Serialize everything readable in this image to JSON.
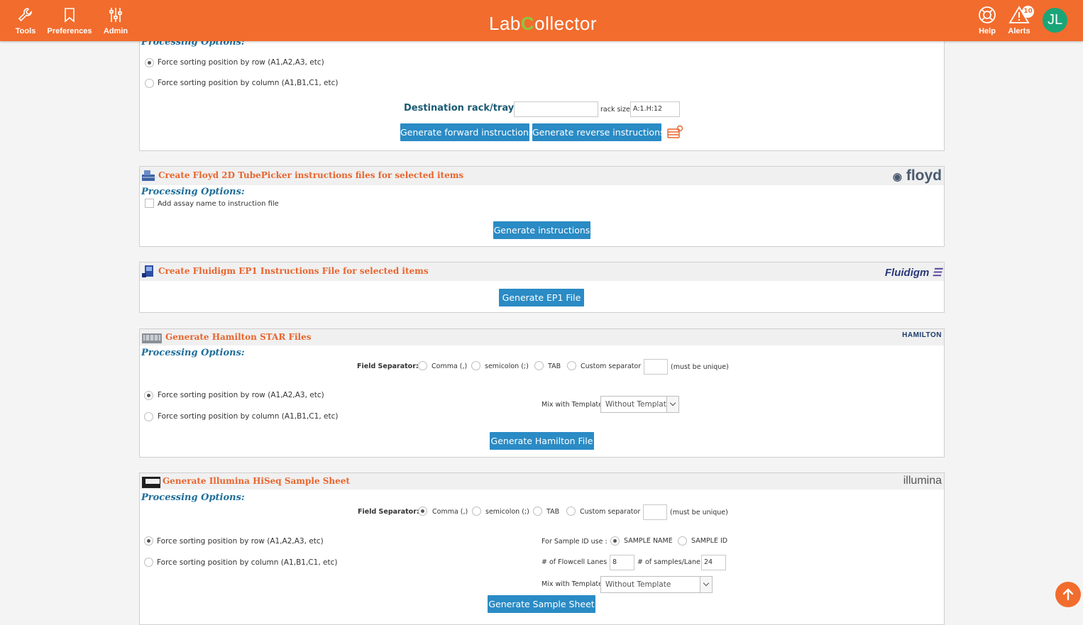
{
  "header": {
    "logo_prefix": "Lab",
    "logo_c": "C",
    "logo_suffix": "ollector",
    "nav_left": [
      "Tools",
      "Preferences",
      "Admin"
    ],
    "help_label": "Help",
    "alerts_label": "Alerts",
    "alerts_count": "10",
    "avatar_initials": "JL",
    "accent_color": "#f26c2d"
  },
  "panel1": {
    "processing_label": "Processing Options:",
    "sort_row": "Force sorting position by row (A1,A2,A3, etc)",
    "sort_col": "Force sorting position by column (A1,B1,C1, etc)",
    "dest_label": "Destination rack/tray :",
    "dest_value": "",
    "rack_size_label": "rack size",
    "rack_size_value": "A:1.H:12",
    "btn_forward": "Generate forward instructions",
    "btn_reverse": "Generate reverse instructions"
  },
  "panel2": {
    "title": "Create Floyd 2D TubePicker instructions files for selected items",
    "brand": "floyd",
    "processing_label": "Processing Options:",
    "checkbox_label": "Add assay name to instruction file",
    "btn": "Generate instructions"
  },
  "panel3": {
    "title": "Create Fluidigm EP1 Instructions File for selected items",
    "brand": "Fluidigm",
    "btn": "Generate EP1 File"
  },
  "panel4": {
    "title": "Generate Hamilton STAR Files",
    "brand": "HAMILTON",
    "processing_label": "Processing Options:",
    "field_sep_label": "Field Separator:",
    "sep_comma": "Comma (,)",
    "sep_semicolon": "semicolon (;)",
    "sep_tab": "TAB",
    "sep_custom": "Custom separator",
    "must_unique": "(must be unique)",
    "sort_row": "Force sorting position by row (A1,A2,A3, etc)",
    "sort_col": "Force sorting position by column (A1,B1,C1, etc)",
    "mix_label": "Mix with Template",
    "mix_value": "Without Template",
    "btn": "Generate Hamilton File"
  },
  "panel5": {
    "title": "Generate Illumina HiSeq Sample Sheet",
    "brand": "illumina",
    "processing_label": "Processing Options:",
    "field_sep_label": "Field Separator:",
    "sep_comma": "Comma (,)",
    "sep_semicolon": "semicolon (;)",
    "sep_tab": "TAB",
    "sep_custom": "Custom separator",
    "must_unique": "(must be unique)",
    "sort_row": "Force sorting position by row (A1,A2,A3, etc)",
    "sort_col": "Force sorting position by column (A1,B1,C1, etc)",
    "sample_id_label": "For Sample ID use :",
    "sample_name": "SAMPLE NAME",
    "sample_id": "SAMPLE ID",
    "flowcell_label": "# of Flowcell Lanes :",
    "flowcell_value": "8",
    "per_lane_label": "# of samples/Lane :",
    "per_lane_value": "24",
    "mix_label": "Mix with Template",
    "mix_value": "Without Template",
    "btn": "Generate Sample Sheet"
  }
}
